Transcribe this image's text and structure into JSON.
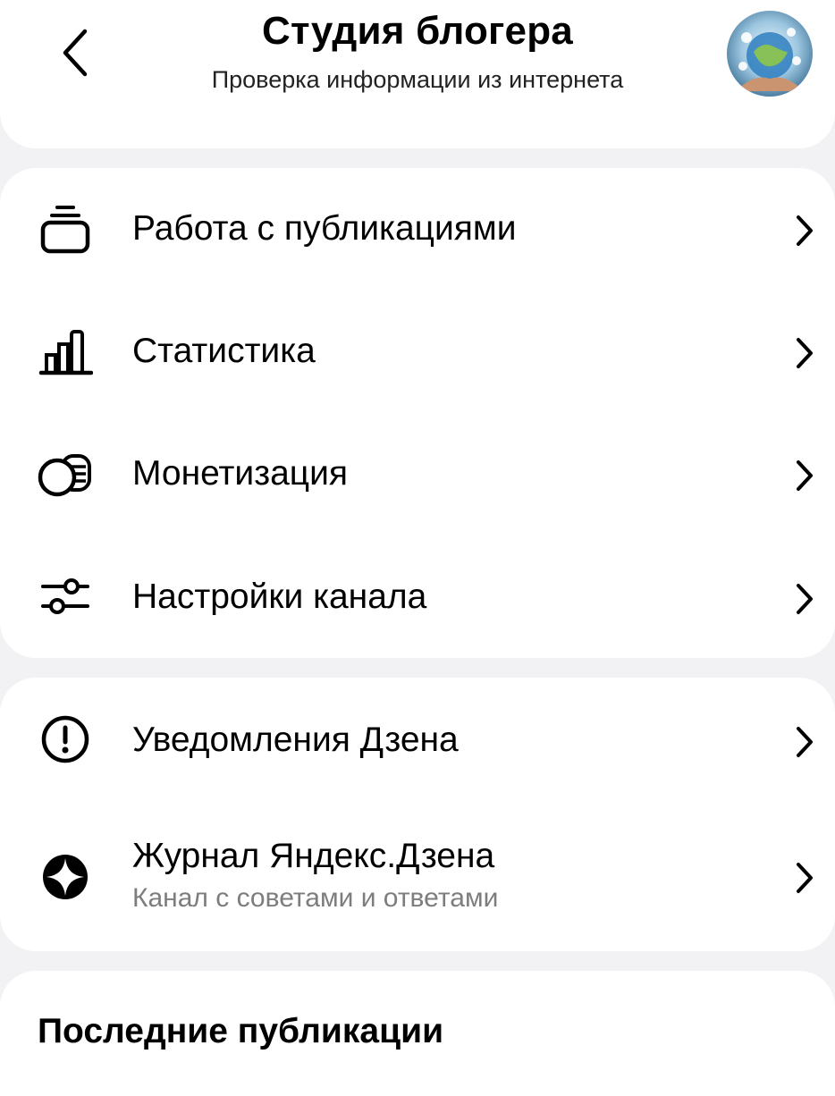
{
  "header": {
    "title": "Студия блогера",
    "subtitle": "Проверка информации из интернета"
  },
  "menu_main": [
    {
      "label": "Работа с публикациями",
      "icon": "publications-icon"
    },
    {
      "label": "Статистика",
      "icon": "bar-chart-icon"
    },
    {
      "label": "Монетизация",
      "icon": "coins-icon"
    },
    {
      "label": "Настройки канала",
      "icon": "sliders-icon"
    }
  ],
  "menu_secondary": [
    {
      "label": "Уведомления Дзена",
      "icon": "exclamation-circle-icon"
    },
    {
      "label": "Журнал Яндекс.Дзена",
      "sublabel": "Канал с советами и ответами",
      "icon": "zen-logo-icon"
    }
  ],
  "recent": {
    "title": "Последние публикации"
  },
  "colors": {
    "background": "#f2f2f4",
    "card": "#ffffff",
    "text": "#000000",
    "secondary_text": "#7d7d7d"
  }
}
